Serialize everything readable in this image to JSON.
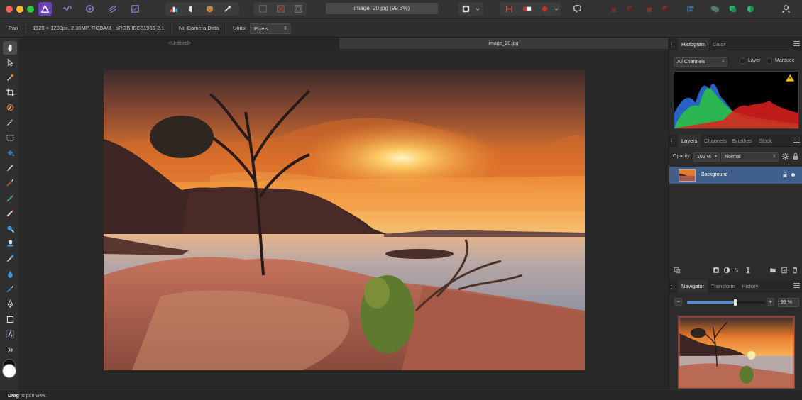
{
  "window": {
    "document_title": "image_20.jpg (99.3%)"
  },
  "context_toolbar": {
    "tool_name": "Pan",
    "image_info": "1920 × 1200px, 2.30MP, RGBA/8 - sRGB IEC61966-2.1",
    "camera_info": "No Camera Data",
    "units_label": "Units:",
    "units_value": "Pixels"
  },
  "document_tabs": [
    {
      "label": "<Untitled>",
      "active": false
    },
    {
      "label": "image_20.jpg",
      "active": true
    }
  ],
  "panels": {
    "histogram": {
      "tabs": [
        "Histogram",
        "Color"
      ],
      "channel_select": "All Channels",
      "layer_label": "Layer",
      "marquee_label": "Marquee",
      "warning_icon": "warning-icon"
    },
    "layers": {
      "tabs": [
        "Layers",
        "Channels",
        "Brushes",
        "Stock"
      ],
      "opacity_label": "Opacity:",
      "opacity_value": "100 %",
      "blend_mode": "Normal",
      "items": [
        {
          "name": "Background",
          "selected": true
        }
      ]
    },
    "navigator": {
      "tabs": [
        "Navigator",
        "Transform",
        "History"
      ],
      "zoom_value": "99 %",
      "zoom_slider_fraction": 0.62,
      "minus_label": "−",
      "plus_label": "+"
    }
  },
  "status": {
    "bold_text": "Drag",
    "text": "to pan view."
  },
  "colors": {
    "accent": "#4a90e2",
    "selection": "#3f5f8a",
    "app_background": "#2b2b2b"
  }
}
